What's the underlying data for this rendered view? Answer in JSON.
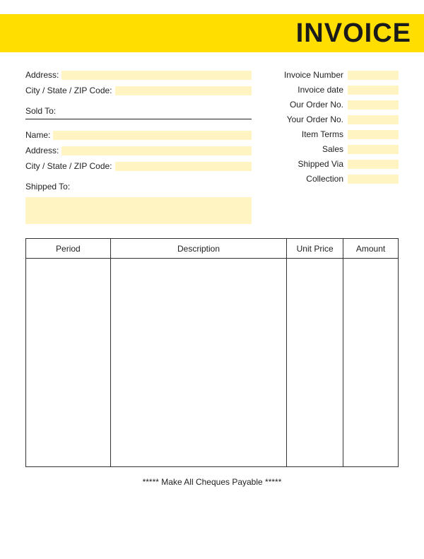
{
  "header": {
    "title": "INVOICE"
  },
  "from": {
    "address_label": "Address:",
    "address_value": "",
    "citystatezip_label": "City / State / ZIP Code:",
    "citystatezip_value": ""
  },
  "sold_to": {
    "section_label": "Sold To:",
    "name_label": "Name:",
    "name_value": "",
    "address_label": "Address:",
    "address_value": "",
    "citystatezip_label": "City / State / ZIP Code:",
    "citystatezip_value": ""
  },
  "shipped_to": {
    "section_label": "Shipped To:",
    "value": ""
  },
  "meta": {
    "invoice_number_label": "Invoice Number",
    "invoice_number_value": "",
    "invoice_date_label": "Invoice date",
    "invoice_date_value": "",
    "our_order_label": "Our Order No.",
    "our_order_value": "",
    "your_order_label": "Your Order No.",
    "your_order_value": "",
    "item_terms_label": "Item Terms",
    "item_terms_value": "",
    "sales_label": "Sales",
    "sales_value": "",
    "shipped_via_label": "Shipped Via",
    "shipped_via_value": "",
    "collection_label": "Collection",
    "collection_value": ""
  },
  "table": {
    "headers": {
      "period": "Period",
      "description": "Description",
      "unit_price": "Unit Price",
      "amount": "Amount"
    },
    "rows": [
      {
        "period": "",
        "description": "",
        "unit_price": "",
        "amount": ""
      }
    ]
  },
  "footer": {
    "cheques": "***** Make All Cheques Payable *****"
  }
}
